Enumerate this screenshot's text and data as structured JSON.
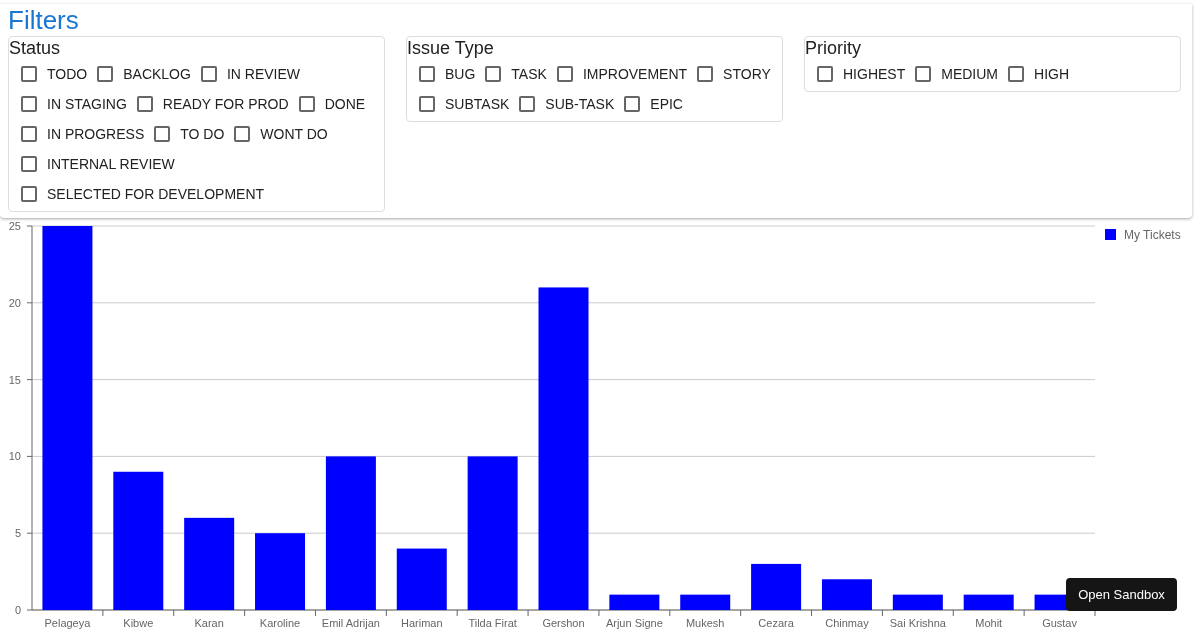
{
  "title": "Filters",
  "groups": [
    {
      "label": "Status",
      "options": [
        {
          "label": "TODO",
          "checked": false
        },
        {
          "label": "BACKLOG",
          "checked": false
        },
        {
          "label": "IN REVIEW",
          "checked": false
        },
        {
          "label": "IN STAGING",
          "checked": false
        },
        {
          "label": "READY FOR PROD",
          "checked": false
        },
        {
          "label": "DONE",
          "checked": false
        },
        {
          "label": "IN PROGRESS",
          "checked": false
        },
        {
          "label": "TO DO",
          "checked": false
        },
        {
          "label": "WONT DO",
          "checked": false
        },
        {
          "label": "INTERNAL REVIEW",
          "checked": false
        },
        {
          "label": "SELECTED FOR DEVELOPMENT",
          "checked": false
        }
      ]
    },
    {
      "label": "Issue Type",
      "options": [
        {
          "label": "BUG",
          "checked": false
        },
        {
          "label": "TASK",
          "checked": false
        },
        {
          "label": "IMPROVEMENT",
          "checked": false
        },
        {
          "label": "STORY",
          "checked": false
        },
        {
          "label": "SUBTASK",
          "checked": false
        },
        {
          "label": "SUB-TASK",
          "checked": false
        },
        {
          "label": "EPIC",
          "checked": false
        }
      ]
    },
    {
      "label": "Priority",
      "options": [
        {
          "label": "HIGHEST",
          "checked": false
        },
        {
          "label": "MEDIUM",
          "checked": false
        },
        {
          "label": "HIGH",
          "checked": false
        }
      ]
    }
  ],
  "chart": {
    "chart_data": {
      "type": "bar",
      "categories": [
        "Pelageya",
        "Kibwe",
        "Karan",
        "Karoline",
        "Emil Adrijan",
        "Hariman",
        "Tilda Firat",
        "Gershon",
        "Arjun Signe",
        "Mukesh",
        "Cezara",
        "Chinmay",
        "Sai Krishna",
        "Mohit",
        "Gustav"
      ],
      "series": [
        {
          "name": "My Tickets",
          "color": "#0000ff",
          "values": [
            25,
            9,
            6,
            5,
            10,
            4,
            10,
            21,
            1,
            1,
            3,
            2,
            1,
            1,
            1
          ]
        }
      ],
      "ylim": [
        0,
        25
      ],
      "grid": true,
      "yticks": [
        0,
        5,
        10,
        15,
        20,
        25
      ]
    }
  },
  "sandbox_button": "Open Sandbox"
}
